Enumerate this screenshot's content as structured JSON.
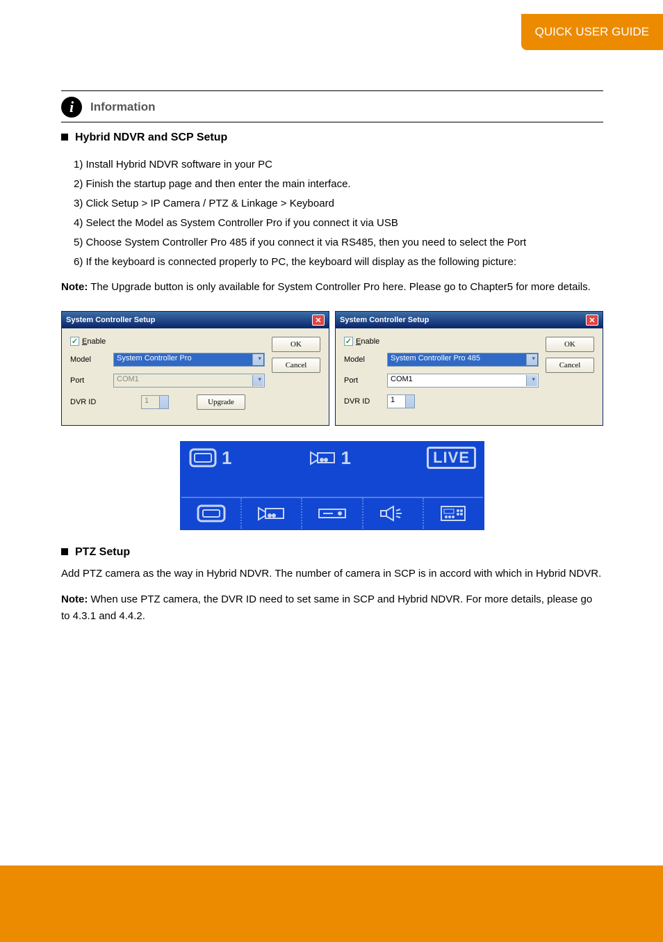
{
  "header": {
    "tab": "QUICK USER GUIDE"
  },
  "info": {
    "label": "Information"
  },
  "section1": {
    "title": "Hybrid NDVR and SCP Setup",
    "lines": [
      "1)  Install Hybrid NDVR software in your PC",
      "2)  Finish the startup page and then enter the main interface.",
      "3)  Click Setup > IP Camera / PTZ & Linkage > Keyboard",
      "4)  Select the Model as System Controller Pro if you connect it via USB",
      "5)  Choose System Controller Pro 485 if you connect it via RS485, then you need to select the Port",
      "6)  If the keyboard is connected properly to PC, the keyboard will display as the following picture:"
    ],
    "note_prefix": "Note:",
    "note": "The Upgrade button is only available for System Controller Pro here. Please go to Chapter5 for more details."
  },
  "dialogs": {
    "title": "System Controller Setup",
    "enable_label": "Enable",
    "model_label": "Model",
    "port_label": "Port",
    "dvrid_label": "DVR ID",
    "ok": "OK",
    "cancel": "Cancel",
    "upgrade": "Upgrade",
    "left": {
      "model": "System Controller Pro",
      "port": "COM1",
      "dvrid": "1"
    },
    "right": {
      "model": "System Controller Pro 485",
      "port": "COM1",
      "dvrid": "1"
    }
  },
  "lcd": {
    "monitor_num": "1",
    "camera_num": "1",
    "live": "LIVE"
  },
  "section2": {
    "title": "PTZ Setup",
    "p1": "Add PTZ camera as the way in Hybrid NDVR. The number of camera in SCP is in accord with which in Hybrid NDVR.",
    "p2_label": "Note:",
    "p2": "When use PTZ camera, the DVR ID need to set same in SCP and Hybrid NDVR. For more details, please go to 4.3.1 and 4.4.2."
  }
}
